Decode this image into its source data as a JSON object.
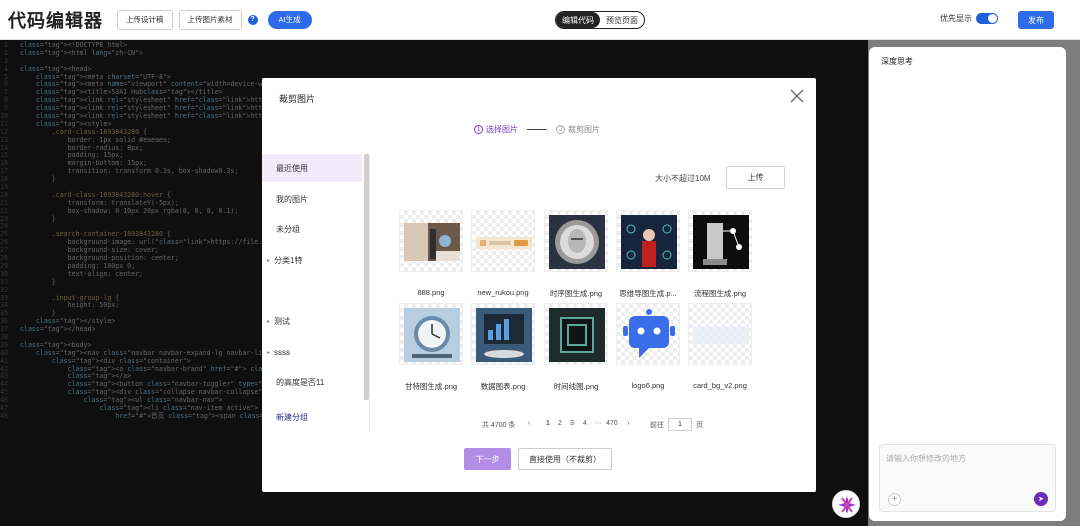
{
  "topbar": {
    "title": "代码编辑器",
    "upload_design": "上传设计稿",
    "upload_image": "上传图片素材",
    "ai_generate": "AI生成",
    "mode_edit": "编辑代码",
    "mode_preview": "预览页面",
    "priority_label": "优先显示",
    "publish": "发布"
  },
  "right_panel": {
    "title": "深度思考",
    "input_placeholder": "请输入你想修改的地方"
  },
  "code_lines": [
    [
      "1",
      "<!DOCTYPE html>"
    ],
    [
      "2",
      "<html lang=\"zh-CN\">"
    ],
    [
      "3",
      ""
    ],
    [
      "4",
      "<head>"
    ],
    [
      "5",
      "    <meta charset=\"UTF-8\">"
    ],
    [
      "6",
      "    <meta name=\"viewport\" content=\"width=device-width, i"
    ],
    [
      "7",
      "    <title>53AI Hub</title>"
    ],
    [
      "8",
      "    <link rel=\"stylesheet\" href=\"https://uploadfile.ltdcdn"
    ],
    [
      "9",
      "    <link rel=\"stylesheet\" href=\"https://static.ltdcdn.c"
    ],
    [
      "10",
      "    <link rel=\"stylesheet\" href=\"https://static.ltdcdn.c"
    ],
    [
      "11",
      "    <style>"
    ],
    [
      "12",
      "        .card-class-1693843280 {"
    ],
    [
      "13",
      "            border: 1px solid #eaeaea;"
    ],
    [
      "14",
      "            border-radius: 8px;"
    ],
    [
      "15",
      "            padding: 15px;"
    ],
    [
      "16",
      "            margin-bottom: 15px;"
    ],
    [
      "17",
      "            transition: transform 0.3s, box-shadow0.3s;"
    ],
    [
      "18",
      "        }"
    ],
    [
      "19",
      ""
    ],
    [
      "20",
      "        .card-class-1693843280:hover {"
    ],
    [
      "21",
      "            transform: translateY(-5px);"
    ],
    [
      "22",
      "            box-shadow: 0 10px 20px rgba(0, 0, 0, 0.1);"
    ],
    [
      "23",
      "        }"
    ],
    [
      "24",
      ""
    ],
    [
      "25",
      "        .search-container-1693843280 {"
    ],
    [
      "26",
      "            background-image: url(\"https://file.ltdcdn.c"
    ],
    [
      "27",
      "            background-size: cover;"
    ],
    [
      "28",
      "            background-position: center;"
    ],
    [
      "29",
      "            padding: 100px 0;"
    ],
    [
      "30",
      "            text-align: center;"
    ],
    [
      "31",
      "        }"
    ],
    [
      "32",
      ""
    ],
    [
      "33",
      "        .input-group-lg {"
    ],
    [
      "34",
      "            height: 50px;"
    ],
    [
      "35",
      "        }"
    ],
    [
      "36",
      "    </style>"
    ],
    [
      "37",
      "</head>"
    ],
    [
      "38",
      ""
    ],
    [
      "39",
      "<body>"
    ],
    [
      "40",
      "    <nav class=\"navbar navbar-expand-lg navbar-light bg-"
    ],
    [
      "41",
      "        <div class=\"container\">"
    ],
    [
      "42",
      "            <a class=\"navbar-brand\" href=\"#\"> <img src=\""
    ],
    [
      "43",
      "            </a>"
    ],
    [
      "44",
      "            <button class=\"navbar-toggler\" type=\"button\""
    ],
    [
      "45",
      "            <div class=\"collapse navbar-collapse\" id=\"navbarNav\">"
    ],
    [
      "46",
      "                <ul class=\"navbar-nav\">"
    ],
    [
      "47",
      "                    <li class=\"nav-item active\"> <a class=\"nav-link\""
    ],
    [
      "48",
      "                        href=\"#\">首页 <span class=\"sr-only\">(current)</span></a> </li>"
    ]
  ],
  "modal": {
    "title": "裁剪图片",
    "step1": "选择图片",
    "step2": "裁剪图片",
    "step1_num": "1",
    "step2_num": "2",
    "size_note": "大小不超过10M",
    "upload": "上传",
    "sidebar": [
      {
        "label": "最近使用",
        "active": true,
        "arrow": false
      },
      {
        "label": "我的图片",
        "active": false,
        "arrow": false
      },
      {
        "label": "未分组",
        "active": false,
        "arrow": false
      },
      {
        "label": "分类1特",
        "active": false,
        "arrow": true
      },
      {
        "label": "测试",
        "active": false,
        "arrow": true
      },
      {
        "label": "ssss",
        "active": false,
        "arrow": true
      },
      {
        "label": "的高度是否11",
        "active": false,
        "arrow": false
      },
      {
        "label": "新建分组",
        "active": false,
        "arrow": false
      }
    ],
    "images": [
      {
        "name": "888.png"
      },
      {
        "name": "new_rukou.png"
      },
      {
        "name": "时序图生成.png"
      },
      {
        "name": "思维导图生成.p..."
      },
      {
        "name": "流程图生成.png"
      },
      {
        "name": "甘特图生成.png"
      },
      {
        "name": "数据图表.png"
      },
      {
        "name": "时间线图.png"
      },
      {
        "name": "logo6.png"
      },
      {
        "name": "card_bg_v2.png"
      }
    ],
    "pager": {
      "total": "共 4700 条",
      "prev": "‹",
      "pages": [
        "1",
        "2",
        "3",
        "4",
        "···",
        "470"
      ],
      "next": "›",
      "goto": "前往",
      "page_value": "1",
      "page_unit": "页"
    },
    "next_button": "下一步",
    "direct_button": "直接使用（不裁剪）"
  }
}
